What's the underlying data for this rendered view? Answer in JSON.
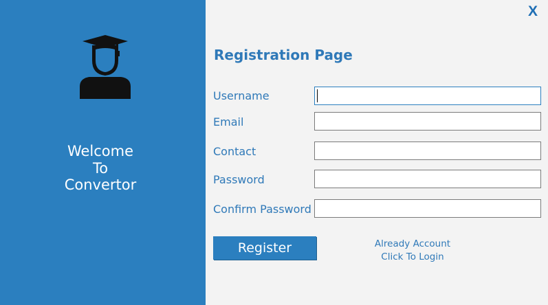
{
  "window": {
    "close_label": "X"
  },
  "left_panel": {
    "welcome_lines": [
      "Welcome",
      "To",
      "Convertor"
    ],
    "avatar_icon": "graduate-user-icon"
  },
  "form": {
    "title": "Registration Page",
    "fields": [
      {
        "label": "Username",
        "value": "",
        "placeholder": ""
      },
      {
        "label": "Email",
        "value": "",
        "placeholder": ""
      },
      {
        "label": "Contact",
        "value": "",
        "placeholder": ""
      },
      {
        "label": "Password",
        "value": "",
        "placeholder": ""
      },
      {
        "label": "Confirm Password",
        "value": "",
        "placeholder": ""
      }
    ],
    "register_label": "Register",
    "login_link_lines": [
      "Already Account",
      "Click To Login"
    ]
  },
  "colors": {
    "accent": "#2b7fbf",
    "background": "#f3f3f3",
    "text_accent": "#2f79b8"
  }
}
